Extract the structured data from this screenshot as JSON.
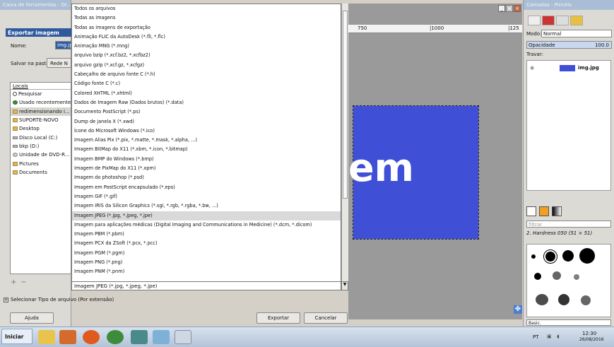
{
  "toolbox": {
    "title": "Caixa de ferramentas - Dr..."
  },
  "dialog": {
    "title": "Exportar imagem",
    "name_label": "Nome:",
    "name_value": "img.jpg",
    "save_in_label": "Salvar na pasta:",
    "save_in_value": "Rede N",
    "places_header": "Locais",
    "places": [
      {
        "label": "Pesquisar",
        "icon": "search-icon"
      },
      {
        "label": "Usado recentemente",
        "icon": "clock-icon"
      },
      {
        "label": "redimensionando i...",
        "icon": "folder-icon"
      },
      {
        "label": "SUPORTE-NOVO",
        "icon": "folder-icon"
      },
      {
        "label": "Desktop",
        "icon": "folder-icon"
      },
      {
        "label": "Disco Local (C:)",
        "icon": "drive-icon"
      },
      {
        "label": "bkp (D:)",
        "icon": "drive-icon"
      },
      {
        "label": "Unidade de DVD-R...",
        "icon": "cd-icon"
      },
      {
        "label": "Pictures",
        "icon": "folder-icon"
      },
      {
        "label": "Documents",
        "icon": "folder-icon"
      }
    ],
    "add_symbol": "+",
    "remove_symbol": "−",
    "file_types": [
      "Todos os arquivos",
      "Todas as imagens",
      "Todas as imagens de exportação",
      "Animação FLIC da AutoDesk (*.fli, *.flc)",
      "Animação MNG (*.mng)",
      "arquivo bzip (*.xcf.bz2, *.xcfbz2)",
      "arquivo gzip (*.xcf.gz, *.xcfgz)",
      "Cabeçalho de arquivo fonte C (*.h)",
      "Código fonte C (*.c)",
      "Colored XHTML (*.xhtml)",
      "Dados de Imagem Raw (Dados brutos) (*.data)",
      "Documento PostScript (*.ps)",
      "Dump de janela X (*.xwd)",
      "Ícone do Microsoft Windows (*.ico)",
      "Imagem Alias Pix (*.pix, *.matte, *.mask, *.alpha, ...)",
      "Imagem BitMap do X11 (*.xbm, *.icon, *.bitmap)",
      "Imagem BMP do Windows (*.bmp)",
      "Imagem de PixMap do X11 (*.xpm)",
      "Imagem do photoshop (*.psd)",
      "Imagem em PostScript encapsulado (*.eps)",
      "Imagem GIF (*.gif)",
      "Imagem IRIS da Silicon Graphics (*.sgi, *.rgb, *.rgba, *.bw, ...)",
      "Imagem JPEG (*.jpg, *.jpeg, *.jpe)",
      "Imagem para aplicações médicas (Digital Imaging and Communications in Medicine) (*.dcm, *.dicom)",
      "Imagem PBM (*.pbm)",
      "Imagem PCX da ZSoft (*.pcx, *.pcc)",
      "Imagem PGM (*.pgm)",
      "Imagem PNG (*.png)",
      "Imagem PNM (*.pnm)"
    ],
    "selected_type": "Imagem JPEG (*.jpg, *.jpeg, *.jpe)",
    "select_type_label": "Selecionar Tipo de arquivo (Por extensão)",
    "help_label": "Ajuda",
    "export_label": "Exportar",
    "cancel_label": "Cancelar"
  },
  "canvas": {
    "ruler_marks": [
      "750",
      "|1000",
      "|125"
    ],
    "image_text": "em"
  },
  "right_panel": {
    "title": "Camadas - Pincéis",
    "mode_label": "Modo:",
    "mode_value": "Normal",
    "opacity_label": "Opacidade",
    "opacity_value": "100.0",
    "lock_label": "Travar:",
    "layer_name": "img.jpg",
    "filter_placeholder": "filtrar",
    "brush_name": "2. Hardness 050 (51 × 51)",
    "preset_value": "Basic."
  },
  "taskbar": {
    "start_label": "Iniciar",
    "lang": "PT",
    "time": "12:30",
    "date": "26/08/2016"
  },
  "colors": {
    "image_blue": "#3f4fd6",
    "title_blue": "#2f5a9e"
  }
}
